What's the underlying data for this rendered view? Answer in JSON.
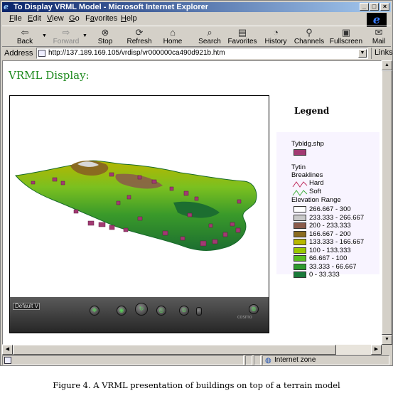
{
  "window": {
    "title": "To Display VRML Model - Microsoft Internet Explorer"
  },
  "menu": {
    "file": {
      "ul": "F",
      "rest": "ile"
    },
    "edit": {
      "ul": "E",
      "rest": "dit"
    },
    "view": {
      "ul": "V",
      "rest": "iew"
    },
    "go": {
      "ul": "G",
      "rest": "o"
    },
    "favorites": {
      "pre": "F",
      "ul": "a",
      "rest": "vorites"
    },
    "help": {
      "ul": "H",
      "rest": "elp"
    }
  },
  "toolbar": {
    "back": "Back",
    "forward": "Forward",
    "stop": "Stop",
    "refresh": "Refresh",
    "home": "Home",
    "search": "Search",
    "favorites": "Favorites",
    "history": "History",
    "channels": "Channels",
    "fullscreen": "Fullscreen",
    "mail": "Mail"
  },
  "address": {
    "label": "Address",
    "url": "http://137.189.169.105/vrdisp/vr000000ca490d921b.htm",
    "links": "Links"
  },
  "page": {
    "heading": "VRML Display:",
    "viewpoint": "Default V",
    "nav_brand": "cosmo"
  },
  "legend": {
    "title": "Legend",
    "layer1": "Tybldg.shp",
    "layer1_color": "#a23a72",
    "layer2": "Tytin",
    "breaklines": "Breaklines",
    "hard": "Hard",
    "soft": "Soft",
    "elevation_title": "Elevation Range",
    "ranges": [
      {
        "label": "266.667 - 300",
        "color": "#ffffff"
      },
      {
        "label": "233.333 - 266.667",
        "color": "#c8c8c8"
      },
      {
        "label": "200 - 233.333",
        "color": "#8a5a4a"
      },
      {
        "label": "166.667 - 200",
        "color": "#8a6a20"
      },
      {
        "label": "133.333 - 166.667",
        "color": "#b8b800"
      },
      {
        "label": "100 - 133.333",
        "color": "#9ac800"
      },
      {
        "label": "66.667 - 100",
        "color": "#5abf20"
      },
      {
        "label": "33.333 - 66.667",
        "color": "#2e9a2e"
      },
      {
        "label": "0 - 33.333",
        "color": "#1a7a3a"
      }
    ]
  },
  "status": {
    "zone": "Internet zone"
  },
  "caption": "Figure 4. A VRML presentation of buildings on top of a terrain model"
}
